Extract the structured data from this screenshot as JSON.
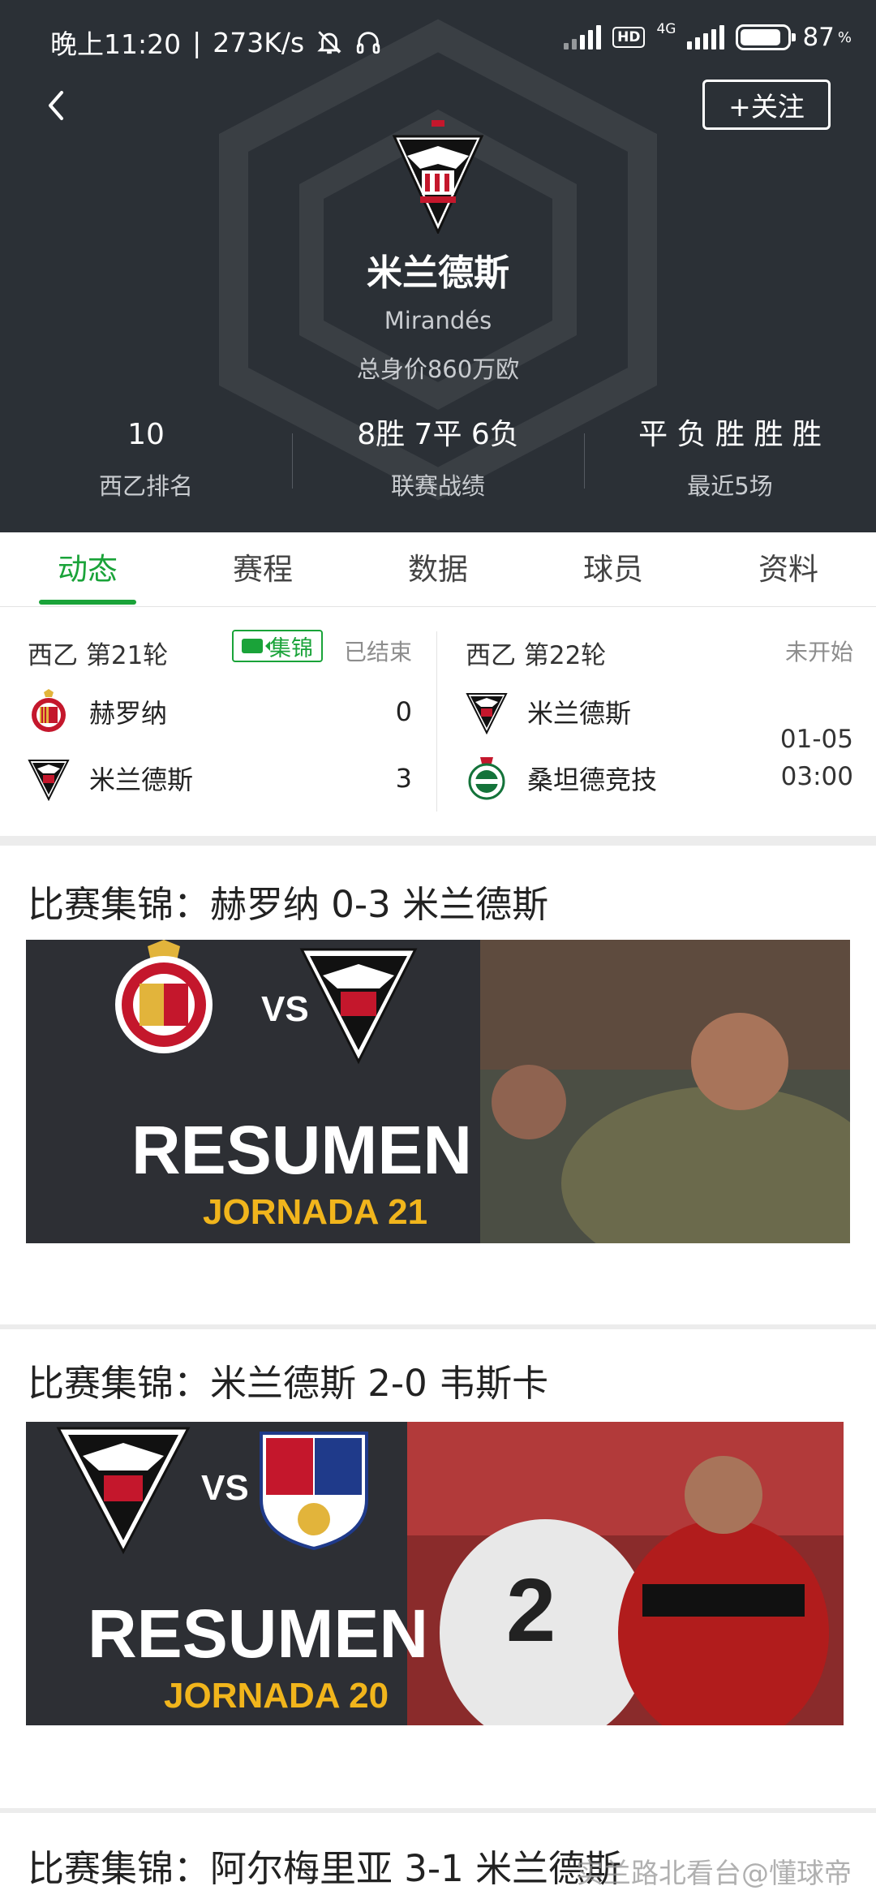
{
  "status_bar": {
    "time": "晚上11:20",
    "speed": "273K/s",
    "network": "4G",
    "hd": "HD",
    "battery": "87",
    "battery_unit": "%",
    "battery_level": 0.87
  },
  "header": {
    "follow_label": "+关注",
    "team_name": "米兰德斯",
    "team_name_en": "Mirandés",
    "market_value": "总身价860万欧",
    "stats": [
      {
        "value": "10",
        "label": "西乙排名"
      },
      {
        "value": "8胜 7平 6负",
        "label": "联赛战绩"
      },
      {
        "value": "平 负 胜 胜 胜",
        "label": "最近5场"
      }
    ]
  },
  "tabs": [
    {
      "label": "动态",
      "active": true
    },
    {
      "label": "赛程",
      "active": false
    },
    {
      "label": "数据",
      "active": false
    },
    {
      "label": "球员",
      "active": false
    },
    {
      "label": "资料",
      "active": false
    }
  ],
  "fixtures": {
    "previous": {
      "round": "西乙 第21轮",
      "highlight_label": "集锦",
      "status": "已结束",
      "home": {
        "name": "赫罗纳",
        "score": "0"
      },
      "away": {
        "name": "米兰德斯",
        "score": "3"
      }
    },
    "next": {
      "round": "西乙 第22轮",
      "status": "未开始",
      "home": {
        "name": "米兰德斯"
      },
      "away": {
        "name": "桑坦德竞技"
      },
      "date": "01-05",
      "time": "03:00"
    }
  },
  "feed": [
    {
      "title": "比赛集锦：赫罗纳 0-3 米兰德斯",
      "thumb_vs": "VS",
      "thumb_word": "RESUMEN",
      "thumb_sub": "JORNADA 21"
    },
    {
      "title": "比赛集锦：米兰德斯 2-0 韦斯卡",
      "thumb_vs": "VS",
      "thumb_word": "RESUMEN",
      "thumb_sub": "JORNADA 20"
    },
    {
      "title": "比赛集锦：阿尔梅里亚 3-1 米兰德斯"
    }
  ],
  "watermark": "@懂球帝",
  "watermark_prefix": "实兰路北看台"
}
